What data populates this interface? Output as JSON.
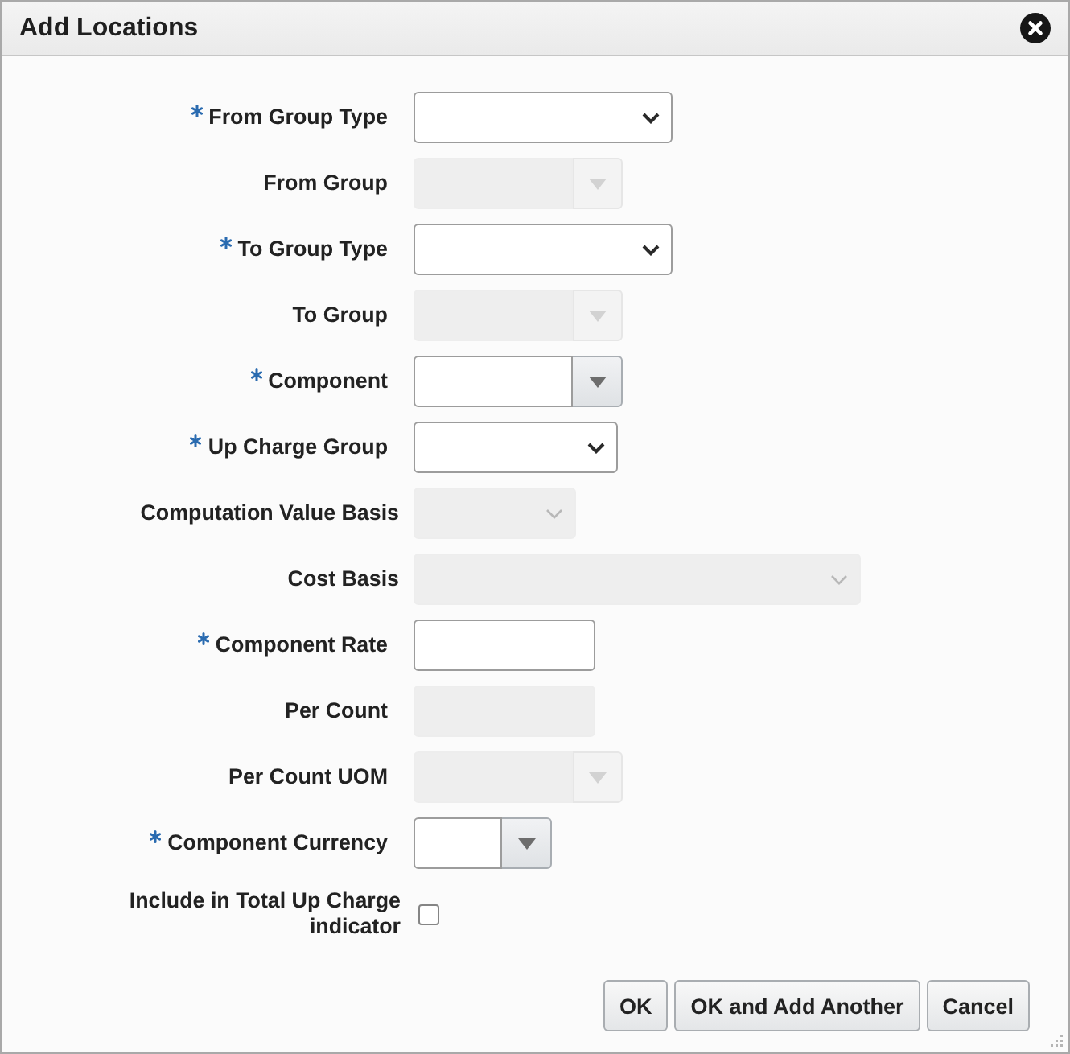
{
  "dialog": {
    "title": "Add Locations"
  },
  "fields": [
    {
      "label": "From Group Type",
      "required": true,
      "kind": "select",
      "disabled": false
    },
    {
      "label": "From Group",
      "required": false,
      "kind": "combobox",
      "disabled": true
    },
    {
      "label": "To Group Type",
      "required": true,
      "kind": "select",
      "disabled": false
    },
    {
      "label": "To Group",
      "required": false,
      "kind": "combobox",
      "disabled": true
    },
    {
      "label": "Component",
      "required": true,
      "kind": "combobox",
      "disabled": false
    },
    {
      "label": "Up Charge Group",
      "required": true,
      "kind": "select",
      "disabled": false
    },
    {
      "label": "Computation Value Basis",
      "required": false,
      "kind": "select",
      "disabled": true
    },
    {
      "label": "Cost Basis",
      "required": false,
      "kind": "select",
      "disabled": true
    },
    {
      "label": "Component Rate",
      "required": true,
      "kind": "text",
      "disabled": false
    },
    {
      "label": "Per Count",
      "required": false,
      "kind": "text",
      "disabled": true
    },
    {
      "label": "Per Count UOM",
      "required": false,
      "kind": "combobox",
      "disabled": true
    },
    {
      "label": "Component Currency",
      "required": true,
      "kind": "combobox",
      "disabled": false
    }
  ],
  "checkbox": {
    "label": "Include in Total Up Charge indicator",
    "checked": false
  },
  "buttons": [
    "OK",
    "OK and Add Another",
    "Cancel"
  ]
}
